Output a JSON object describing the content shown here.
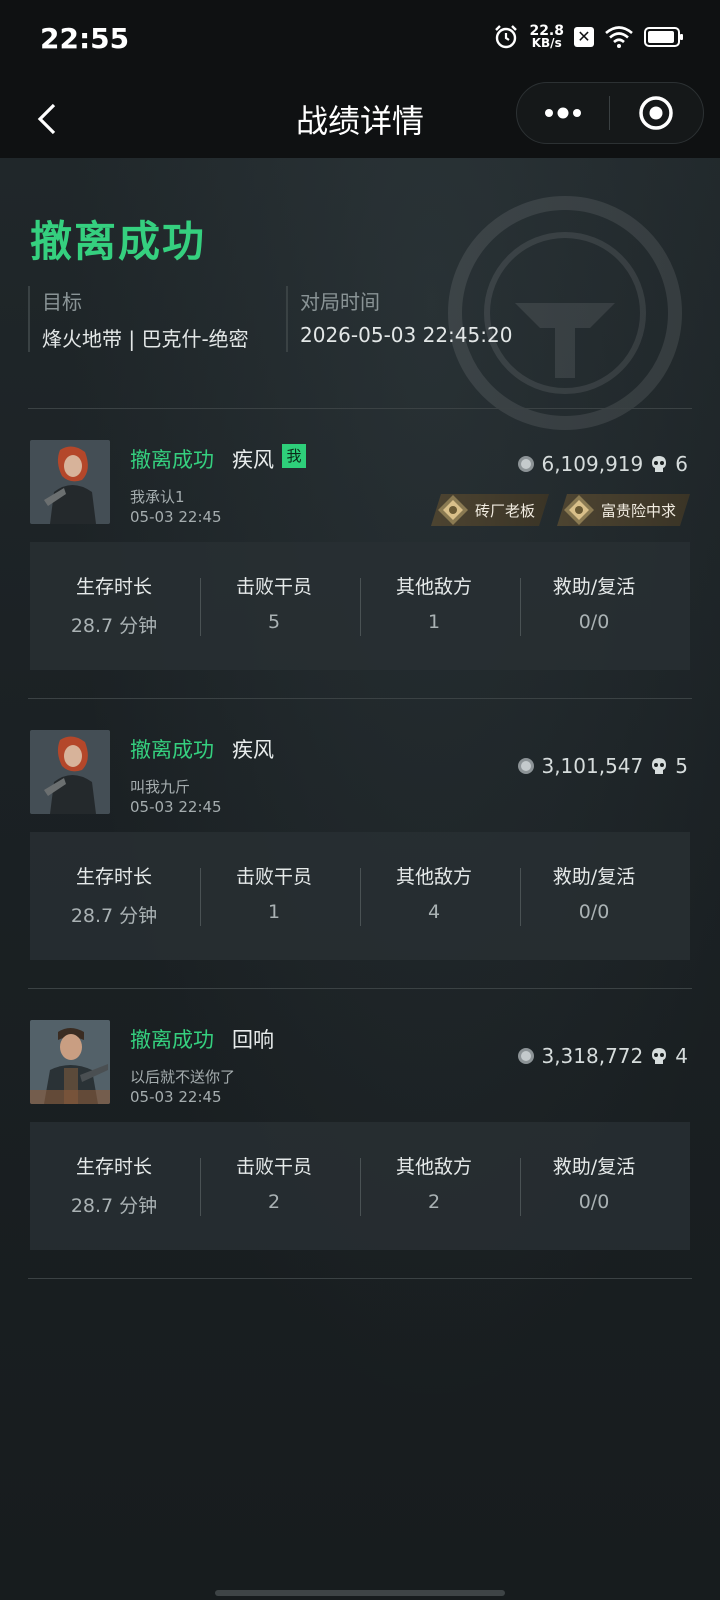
{
  "status_bar": {
    "time": "22:55",
    "net_speed_value": "22.8",
    "net_speed_unit": "KB/s",
    "icons": [
      "alarm-icon",
      "no-sim-icon",
      "wifi-icon",
      "battery-icon"
    ]
  },
  "nav": {
    "title": "战绩详情",
    "back_icon": "chevron-left-icon",
    "more_icon": "more-dots-icon",
    "close_icon": "target-circle-icon"
  },
  "summary": {
    "result": "撤离成功",
    "target_label": "目标",
    "target_value": "烽火地带 | 巴克什-绝密",
    "time_label": "对局时间",
    "time_value": "2026-05-03 22:45:20"
  },
  "stat_labels": {
    "survival": "生存时长",
    "kills": "击败干员",
    "other": "其他敌方",
    "assist": "救助/复活"
  },
  "players": [
    {
      "status": "撤离成功",
      "hero": "疾风",
      "me_tag": "我",
      "name": "我承认1",
      "date": "05-03 22:45",
      "coins": "6,109,919",
      "kills_badge": "6",
      "badges": [
        "砖厂老板",
        "富贵险中求"
      ],
      "survival": "28.7 分钟",
      "kills": "5",
      "other": "1",
      "assist": "0/0"
    },
    {
      "status": "撤离成功",
      "hero": "疾风",
      "name": "叫我九斤",
      "date": "05-03 22:45",
      "coins": "3,101,547",
      "kills_badge": "5",
      "survival": "28.7 分钟",
      "kills": "1",
      "other": "4",
      "assist": "0/0"
    },
    {
      "status": "撤离成功",
      "hero": "回响",
      "name": "以后就不送你了",
      "date": "05-03 22:45",
      "coins": "3,318,772",
      "kills_badge": "4",
      "survival": "28.7 分钟",
      "kills": "2",
      "other": "2",
      "assist": "0/0"
    }
  ],
  "colors": {
    "accent_green": "#35d07f",
    "background": "#1a1f20",
    "badge_gold": "#4d4431"
  }
}
